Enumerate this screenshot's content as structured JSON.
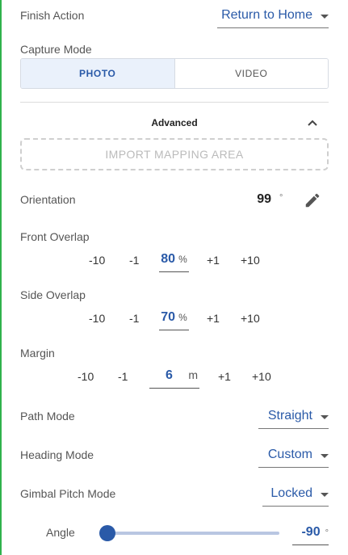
{
  "finish_action": {
    "label": "Finish Action",
    "value": "Return to Home"
  },
  "capture_mode": {
    "label": "Capture Mode",
    "options": [
      "PHOTO",
      "VIDEO"
    ],
    "selected": "PHOTO"
  },
  "advanced": {
    "label": "Advanced",
    "collapse_icon": "chevron-up-icon"
  },
  "import_button": {
    "label": "IMPORT MAPPING AREA"
  },
  "orientation": {
    "label": "Orientation",
    "value": "99",
    "unit": "°",
    "edit_icon": "pencil-icon"
  },
  "front_overlap": {
    "label": "Front Overlap",
    "steps": [
      "-10",
      "-1",
      "+1",
      "+10"
    ],
    "value": "80",
    "unit": "%"
  },
  "side_overlap": {
    "label": "Side Overlap",
    "steps": [
      "-10",
      "-1",
      "+1",
      "+10"
    ],
    "value": "70",
    "unit": "%"
  },
  "margin": {
    "label": "Margin",
    "steps": [
      "-10",
      "-1",
      "+1",
      "+10"
    ],
    "value": "6",
    "unit": "m"
  },
  "path_mode": {
    "label": "Path Mode",
    "value": "Straight"
  },
  "heading_mode": {
    "label": "Heading Mode",
    "value": "Custom"
  },
  "gimbal_pitch_mode": {
    "label": "Gimbal Pitch Mode",
    "value": "Locked"
  },
  "angle": {
    "label": "Angle",
    "value": "-90",
    "unit": "°",
    "slider_fraction": 0.0
  },
  "colors": {
    "accent": "#2a5aa8",
    "green_edge": "#2fb24c"
  }
}
